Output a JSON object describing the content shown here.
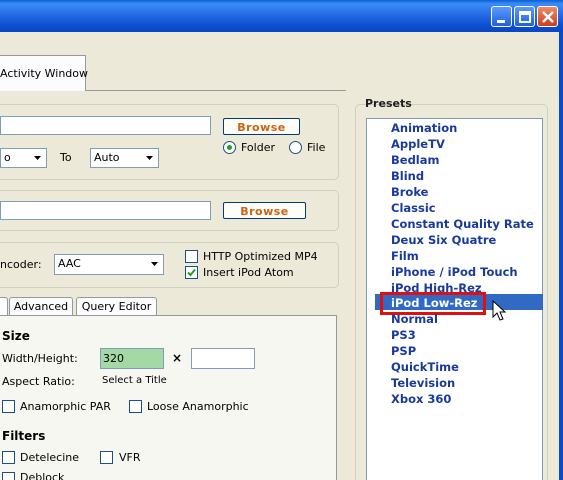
{
  "tabs": {
    "activity_window": "Activity Window"
  },
  "source": {
    "browse_label": "Browse",
    "folder_label": "Folder",
    "file_label": "File",
    "range_to_label": "To",
    "range_from_value": "o",
    "range_to_value": "Auto",
    "selected_mode": "Folder"
  },
  "destination": {
    "browse_label": "Browse"
  },
  "audio": {
    "encoder_label": "ncoder:",
    "encoder_value": "AAC",
    "http_optimized_label": "HTTP Optimized MP4",
    "http_optimized_checked": false,
    "insert_ipod_atom_label": "Insert iPod Atom",
    "insert_ipod_atom_checked": true
  },
  "lower_tabs": {
    "advanced": "Advanced",
    "query_editor": "Query Editor"
  },
  "picture": {
    "size_heading": "Size",
    "width_height_label": "Width/Height:",
    "width_value": "320",
    "times_symbol": "×",
    "aspect_ratio_label": "Aspect Ratio:",
    "aspect_ratio_value": "Select a Title",
    "anamorphic_par_label": "Anamorphic PAR",
    "loose_anamorphic_label": "Loose Anamorphic",
    "filters_heading": "Filters",
    "detelecine_label": "Detelecine",
    "vfr_label": "VFR",
    "deblock_label": "Deblock"
  },
  "presets": {
    "title": "Presets",
    "items": [
      "Animation",
      "AppleTV",
      "Bedlam",
      "Blind",
      "Broke",
      "Classic",
      "Constant Quality Rate",
      "Deux Six Quatre",
      "Film",
      "iPhone / iPod Touch",
      "iPod High-Rez",
      "iPod Low-Rez",
      "Normal",
      "PS3",
      "PSP",
      "QuickTime",
      "Television",
      "Xbox 360"
    ],
    "selected": "iPod Low-Rez"
  },
  "colors": {
    "title_bar": "#2a6fe8",
    "selection": "#316ac5",
    "preset_text": "#1a3a9a",
    "browse_text": "#c86414",
    "highlight_box": "#e01010",
    "width_field": "#a4d8a4"
  }
}
